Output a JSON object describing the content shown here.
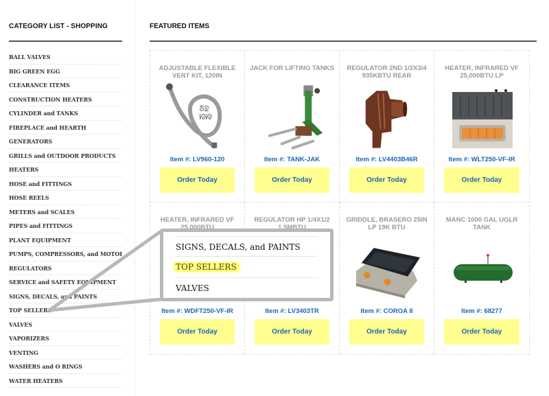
{
  "sidebar": {
    "title": "CATEGORY LIST - SHOPPING",
    "items": [
      {
        "label": "BALL VALVES"
      },
      {
        "label": "BIG GREEN EGG"
      },
      {
        "label": "CLEARANCE ITEMS"
      },
      {
        "label": "CONSTRUCTION HEATERS"
      },
      {
        "label": "CYLINDER and TANKS"
      },
      {
        "label": "FIREPLACE and HEARTH"
      },
      {
        "label": "GENERATORS"
      },
      {
        "label": "GRILLS and OUTDOOR PRODUCTS"
      },
      {
        "label": "HEATERS"
      },
      {
        "label": "HOSE and FITTINGS"
      },
      {
        "label": "HOSE REELS"
      },
      {
        "label": "METERS and SCALES"
      },
      {
        "label": "PIPES and FITTINGS"
      },
      {
        "label": "PLANT EQUIPMENT"
      },
      {
        "label": "PUMPS, COMPRESSORS, and MOTORS"
      },
      {
        "label": "REGULATORS"
      },
      {
        "label": "SERVICE and SAFETY EQUIPMENT"
      },
      {
        "label": "SIGNS, DECALS, and PAINTS"
      },
      {
        "label": "TOP SELLERS"
      },
      {
        "label": "VALVES"
      },
      {
        "label": "VAPORIZERS"
      },
      {
        "label": "VENTING"
      },
      {
        "label": "WASHERS and O RINGS"
      },
      {
        "label": "WATER HEATERS"
      }
    ]
  },
  "main": {
    "title": "FEATURED ITEMS",
    "products": [
      {
        "title": "ADJUSTABLE FLEXIBLE VENT KIT, 120IN",
        "sku": "Item #: LV960-120",
        "button": "Order Today",
        "image": "flexible-vent-hose"
      },
      {
        "title": "JACK FOR LIFTING TANKS",
        "sku": "Item #: TANK-JAK",
        "button": "Order Today",
        "image": "tank-jack"
      },
      {
        "title": "REGULATOR 2ND 1/2X3/4 935KBTU REAR",
        "sku": "Item #: LV4403B46R",
        "button": "Order Today",
        "image": "regulator-brown"
      },
      {
        "title": "HEATER, INFRARED VF 25,000BTU LP",
        "sku": "Item #: WLT250-VF-IR",
        "button": "Order Today",
        "image": "infrared-heater"
      },
      {
        "title": "HEATER, INFRARED VF 25,000BTU",
        "sku": "Item #: WDFT250-VF-IR",
        "button": "Order Today",
        "image": "infrared-heater"
      },
      {
        "title": "REGULATOR HP 1/4X1/2 1.5MBTU",
        "sku": "Item #: LV3403TR",
        "button": "Order Today",
        "image": "regulator"
      },
      {
        "title": "GRIDDLE, BRASERO 25IN LP 19K BTU",
        "sku": "Item #: COROA II",
        "button": "Order Today",
        "image": "griddle"
      },
      {
        "title": "MANC 1000 GAL UGLR TANK",
        "sku": "Item #: 68277",
        "button": "Order Today",
        "image": "propane-tank"
      }
    ]
  },
  "magnifier": {
    "items": [
      {
        "label": "SIGNS, DECALS, and PAINTS",
        "highlighted": false
      },
      {
        "label": "TOP SELLERS",
        "highlighted": true
      },
      {
        "label": "VALVES",
        "highlighted": false
      }
    ],
    "target": "TOP SELLERS"
  },
  "colors": {
    "sku_text": "#1a66b3",
    "button_bg": "#ffff90",
    "title_gray": "#999999",
    "highlight": "#ffff80"
  }
}
